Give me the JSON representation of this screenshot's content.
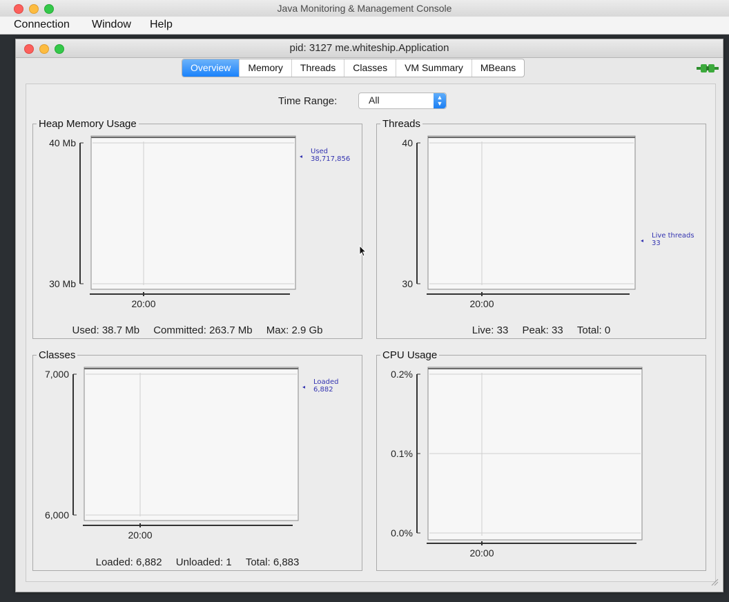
{
  "outer_window": {
    "title": "Java Monitoring & Management Console",
    "menu": [
      "Connection",
      "Window",
      "Help"
    ]
  },
  "inner_window": {
    "title": "pid: 3127 me.whiteship.Application",
    "tabs": [
      {
        "label": "Overview",
        "active": true
      },
      {
        "label": "Memory",
        "active": false
      },
      {
        "label": "Threads",
        "active": false
      },
      {
        "label": "Classes",
        "active": false
      },
      {
        "label": "VM Summary",
        "active": false
      },
      {
        "label": "MBeans",
        "active": false
      }
    ],
    "connect_icon": "plug-connected-icon"
  },
  "time_range": {
    "label": "Time Range:",
    "value": "All"
  },
  "colors": {
    "accent": "#1a82fb",
    "series": "#3333b0",
    "grid": "#cfcfcf"
  },
  "panels": {
    "heap": {
      "title": "Heap Memory Usage",
      "legend_name": "Used",
      "legend_value": "38,717,856",
      "summary": [
        "Used: 38.7 Mb",
        "Committed: 263.7 Mb",
        "Max: 2.9 Gb"
      ]
    },
    "threads": {
      "title": "Threads",
      "legend_name": "Live threads",
      "legend_value": "33",
      "summary": [
        "Live: 33",
        "Peak: 33",
        "Total: 0"
      ]
    },
    "classes": {
      "title": "Classes",
      "legend_name": "Loaded",
      "legend_value": "6,882",
      "summary": [
        "Loaded: 6,882",
        "Unloaded: 1",
        "Total: 6,883"
      ]
    },
    "cpu": {
      "title": "CPU Usage",
      "summary": []
    }
  },
  "chart_data": [
    {
      "type": "line",
      "title": "Heap Memory Usage",
      "y_ticks": [
        "40 Mb",
        "30 Mb"
      ],
      "ylim": [
        30,
        40
      ],
      "x_ticks": [
        "20:00"
      ],
      "series": [
        {
          "name": "Used",
          "values": []
        }
      ]
    },
    {
      "type": "line",
      "title": "Threads",
      "y_ticks": [
        "40",
        "30"
      ],
      "ylim": [
        30,
        40
      ],
      "x_ticks": [
        "20:00"
      ],
      "series": [
        {
          "name": "Live threads",
          "values": []
        }
      ]
    },
    {
      "type": "line",
      "title": "Classes",
      "y_ticks": [
        "7,000",
        "6,000"
      ],
      "ylim": [
        6000,
        7000
      ],
      "x_ticks": [
        "20:00"
      ],
      "series": [
        {
          "name": "Loaded",
          "values": []
        }
      ]
    },
    {
      "type": "line",
      "title": "CPU Usage",
      "y_ticks": [
        "0.2%",
        "0.1%",
        "0.0%"
      ],
      "ylim": [
        0,
        0.2
      ],
      "x_ticks": [
        "20:00"
      ],
      "series": []
    }
  ]
}
